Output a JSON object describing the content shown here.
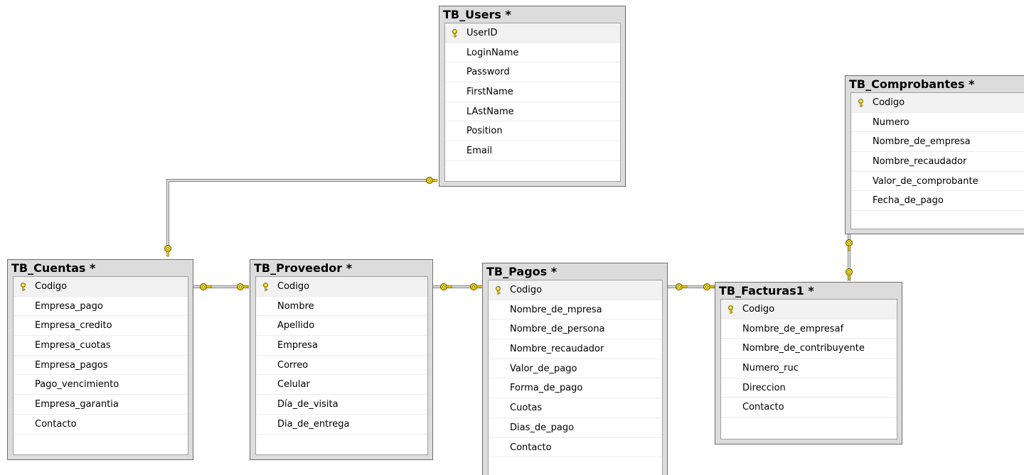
{
  "tables": {
    "users": {
      "title": "TB_Users *",
      "columns": [
        "UserID",
        "LoginName",
        "Password",
        "FirstName",
        "LAstName",
        "Position",
        "Email"
      ]
    },
    "comprobantes": {
      "title": "TB_Comprobantes *",
      "columns": [
        "Codigo",
        "Numero",
        "Nombre_de_empresa",
        "Nombre_recaudador",
        "Valor_de_comprobante",
        "Fecha_de_pago"
      ]
    },
    "cuentas": {
      "title": "TB_Cuentas *",
      "columns": [
        "Codigo",
        "Empresa_pago",
        "Empresa_credito",
        "Empresa_cuotas",
        "Empresa_pagos",
        "Pago_vencimiento",
        "Empresa_garantia",
        "Contacto"
      ]
    },
    "proveedor": {
      "title": "TB_Proveedor *",
      "columns": [
        "Codigo",
        "Nombre",
        "Apellido",
        "Empresa",
        "Correo",
        "Celular",
        "Día_de_visita",
        "Dia_de_entrega"
      ]
    },
    "pagos": {
      "title": "TB_Pagos *",
      "columns": [
        "Codigo",
        "Nombre_de_mpresa",
        "Nombre_de_persona",
        "Nombre_recaudador",
        "Valor_de_pago",
        "Forma_de_pago",
        "Cuotas",
        "Dias_de_pago",
        "Contacto"
      ]
    },
    "facturas": {
      "title": "TB_Facturas1 *",
      "columns": [
        "Codigo",
        "Nombre_de_empresaf",
        "Nombre_de_contribuyente",
        "Numero_ruc",
        "Direccion",
        "Contacto"
      ]
    }
  },
  "colors": {
    "key_icon": "#f0d000",
    "connector": "#808080"
  },
  "icons": {
    "primary_key": "key-icon",
    "relationship_key_end": "key-icon",
    "relationship_many_end": "infinity-icon"
  }
}
